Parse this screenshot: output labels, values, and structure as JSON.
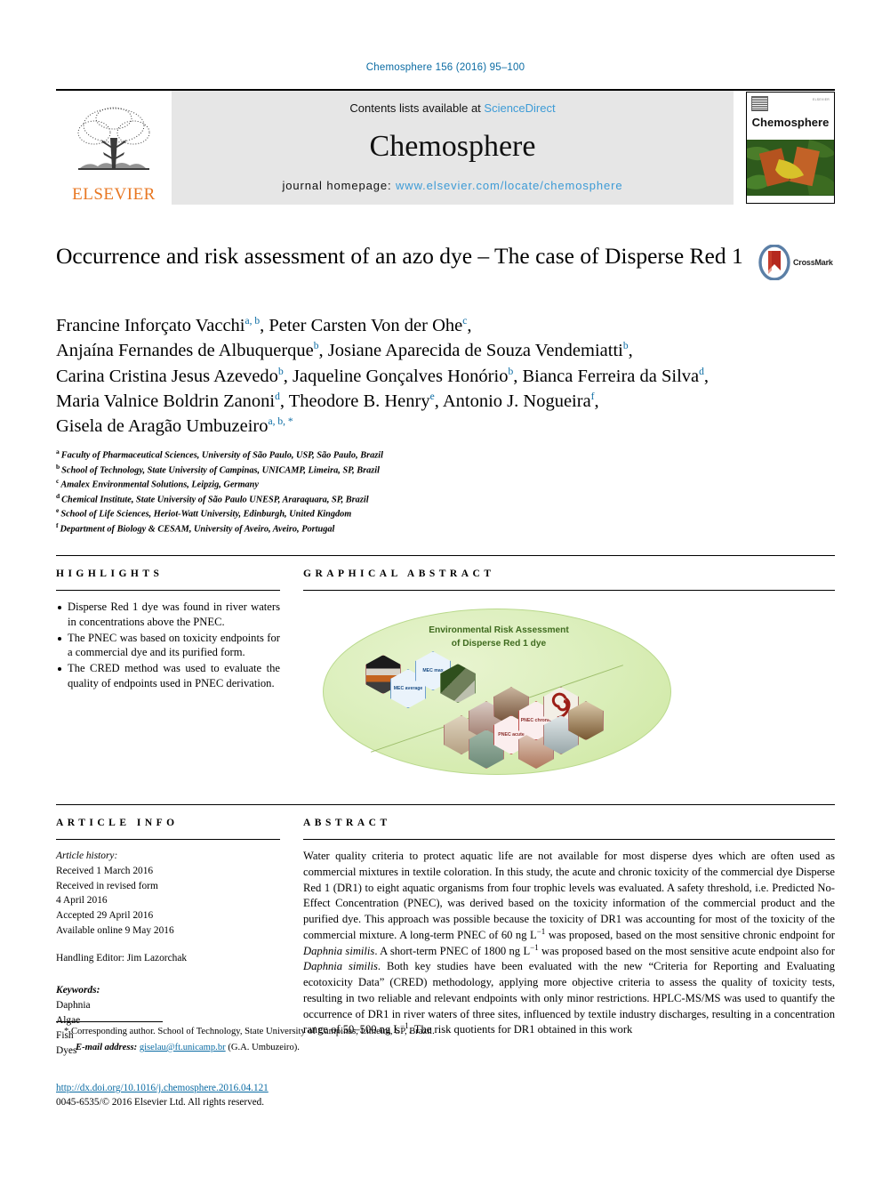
{
  "running_head": "Chemosphere 156 (2016) 95–100",
  "masthead": {
    "publisher": "ELSEVIER",
    "contents_prefix": "Contents lists available at ",
    "contents_link": "ScienceDirect",
    "journal_name": "Chemosphere",
    "homepage_prefix": "journal homepage: ",
    "homepage_url": "www.elsevier.com/locate/chemosphere",
    "cover_title": "Chemosphere",
    "cover_mini_text": "ELSEVIER"
  },
  "article": {
    "title": "Occurrence and risk assessment of an azo dye – The case of Disperse Red 1",
    "crossmark_label": "CrossMark"
  },
  "authors": {
    "lines": [
      {
        "id": "line1"
      },
      {
        "id": "line2"
      },
      {
        "id": "line3"
      },
      {
        "id": "line4"
      },
      {
        "id": "line5"
      }
    ],
    "list": [
      {
        "name": "Francine Inforçato Vacchi",
        "marks": "a, b"
      },
      {
        "name": "Peter Carsten Von der Ohe",
        "marks": "c"
      },
      {
        "name": "Anjaína Fernandes de Albuquerque",
        "marks": "b"
      },
      {
        "name": "Josiane Aparecida de Souza Vendemiatti",
        "marks": "b"
      },
      {
        "name": "Carina Cristina Jesus Azevedo",
        "marks": "b"
      },
      {
        "name": "Jaqueline Gonçalves Honório",
        "marks": "b"
      },
      {
        "name": "Bianca Ferreira da Silva",
        "marks": "d"
      },
      {
        "name": "Maria Valnice Boldrin Zanoni",
        "marks": "d"
      },
      {
        "name": "Theodore B. Henry",
        "marks": "e"
      },
      {
        "name": "Antonio J. Nogueira",
        "marks": "f"
      },
      {
        "name": "Gisela de Aragão Umbuzeiro",
        "marks": "a, b, *"
      }
    ]
  },
  "affiliations": [
    {
      "mark": "a",
      "text": "Faculty of Pharmaceutical Sciences, University of São Paulo, USP, São Paulo, Brazil"
    },
    {
      "mark": "b",
      "text": "School of Technology, State University of Campinas, UNICAMP, Limeira, SP, Brazil"
    },
    {
      "mark": "c",
      "text": "Amalex Environmental Solutions, Leipzig, Germany"
    },
    {
      "mark": "d",
      "text": "Chemical Institute, State University of São Paulo UNESP, Araraquara, SP, Brazil"
    },
    {
      "mark": "e",
      "text": "School of Life Sciences, Heriot-Watt University, Edinburgh, United Kingdom"
    },
    {
      "mark": "f",
      "text": "Department of Biology & CESAM, University of Aveiro, Aveiro, Portugal"
    }
  ],
  "highlights": {
    "heading": "HIGHLIGHTS",
    "items": [
      "Disperse Red 1 dye was found in river waters in concentrations above the PNEC.",
      "The PNEC was based on toxicity endpoints for a commercial dye and its purified form.",
      "The CRED method was used to evaluate the quality of endpoints used in PNEC derivation."
    ]
  },
  "graphical_abstract": {
    "heading": "GRAPHICAL ABSTRACT",
    "figure_title_line1": "Environmental Risk Assessment",
    "figure_title_line2": "of Disperse Red 1 dye",
    "hex_labels": {
      "mec_average": "MEC average",
      "mec_max": "MEC max",
      "pnec_acute": "PNEC acute",
      "pnec_chronic": "PNEC chronic"
    }
  },
  "article_info": {
    "heading": "ARTICLE INFO",
    "history_label": "Article history:",
    "history": [
      "Received 1 March 2016",
      "Received in revised form",
      "4 April 2016",
      "Accepted 29 April 2016",
      "Available online 9 May 2016"
    ],
    "handling_editor": "Handling Editor: Jim Lazorchak",
    "keywords_label": "Keywords:",
    "keywords": [
      "Daphnia",
      "Algae",
      "Fish",
      "Dyes"
    ]
  },
  "abstract": {
    "heading": "ABSTRACT",
    "part1": "Water quality criteria to protect aquatic life are not available for most disperse dyes which are often used as commercial mixtures in textile coloration. In this study, the acute and chronic toxicity of the commercial dye Disperse Red 1 (DR1) to eight aquatic organisms from four trophic levels was evaluated. A safety threshold, i.e. Predicted No-Effect Concentration (PNEC), was derived based on the toxicity information of the commercial product and the purified dye. This approach was possible because the toxicity of DR1 was accounting for most of the toxicity of the commercial mixture. A long-term PNEC of 60 ng L",
    "sup1": "−1",
    "part2": " was proposed, based on the most sensitive chronic endpoint for ",
    "species1": "Daphnia similis",
    "part3": ". A short-term PNEC of 1800 ng L",
    "sup2": "−1",
    "part4": " was proposed based on the most sensitive acute endpoint also for ",
    "species2": "Daphnia similis",
    "part5": ". Both key studies have been evaluated with the new “Criteria for Reporting and Evaluating ecotoxicity Data” (CRED) methodology, applying more objective criteria to assess the quality of toxicity tests, resulting in two reliable and relevant endpoints with only minor restrictions. HPLC-MS/MS was used to quantify the occurrence of DR1 in river waters of three sites, influenced by textile industry discharges, resulting in a concentration range of 50–500 ng L",
    "sup3": "−1",
    "part6": ". The risk quotients for DR1 obtained in this work"
  },
  "footer": {
    "corresponding_note": "* Corresponding author. School of Technology, State University of Campinas, Limeira, SP, Brazil.",
    "email_label": "E-mail address:",
    "email": "giselau@ft.unicamp.br",
    "email_owner": "(G.A. Umbuzeiro).",
    "doi": "http://dx.doi.org/10.1016/j.chemosphere.2016.04.121",
    "copyright": "0045-6535/© 2016 Elsevier Ltd. All rights reserved."
  },
  "colors": {
    "link_blue": "#0a6ba3",
    "elsevier_orange": "#e87722",
    "masthead_grey": "#e6e6e6",
    "ga_green": "#cde79f"
  }
}
